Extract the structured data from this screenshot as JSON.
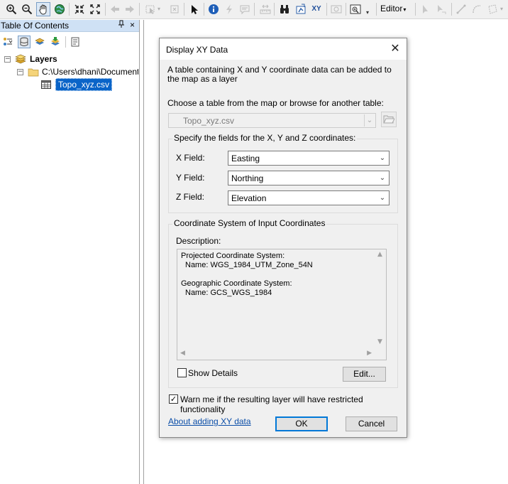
{
  "toolbar": {
    "editor_label": "Editor"
  },
  "toc": {
    "title": "Table Of Contents",
    "pin_glyph": "¤",
    "close_glyph": "×",
    "tree": {
      "layers_label": "Layers",
      "folder_label": "C:\\Users\\dhani\\Documents",
      "table_label": "Topo_xyz.csv"
    }
  },
  "dialog": {
    "title": "Display XY Data",
    "intro": "A table containing X and Y coordinate data can be added to the map as a layer",
    "choose_label": "Choose a table from the map or browse for another table:",
    "table_value": "Topo_xyz.csv",
    "fields_group_label": "Specify the fields for the X, Y and Z coordinates:",
    "x_label": "X Field:",
    "x_value": "Easting",
    "y_label": "Y Field:",
    "y_value": "Northing",
    "z_label": "Z Field:",
    "z_value": "Elevation",
    "coord_group_label": "Coordinate System of Input Coordinates",
    "description_label": "Description:",
    "desc_line1": "Projected Coordinate System:",
    "desc_line2": "Name: WGS_1984_UTM_Zone_54N",
    "desc_line3": "Geographic Coordinate System:",
    "desc_line4": "Name: GCS_WGS_1984",
    "show_details_label": "Show Details",
    "show_details_checked": false,
    "edit_label": "Edit...",
    "warn_label": "Warn me if the resulting layer will have restricted functionality",
    "warn_checked": true,
    "about_link": "About adding XY data",
    "ok_label": "OK",
    "cancel_label": "Cancel"
  }
}
